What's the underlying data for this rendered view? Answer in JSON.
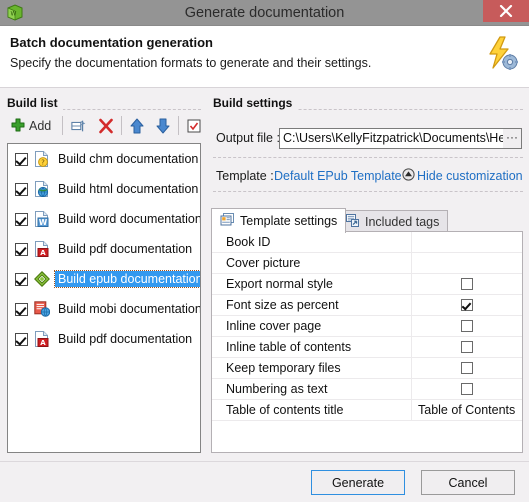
{
  "window": {
    "title": "Generate documentation",
    "app_icon": "green-cube-icon",
    "close_label": "✕"
  },
  "header": {
    "title": "Batch documentation generation",
    "subtitle": "Specify the documentation formats to generate and their settings.",
    "icon": "lightning-gear-icon"
  },
  "build_list": {
    "section_label": "Build list",
    "toolbar": {
      "add_label": "Add",
      "add_icon": "plus-icon",
      "rename_icon": "rename-icon",
      "delete_icon": "delete-x-icon",
      "move_up_icon": "arrow-up-icon",
      "move_down_icon": "arrow-down-icon",
      "check_all_icon": "check-all-icon"
    },
    "items": [
      {
        "label": "Build chm documentation",
        "checked": true,
        "selected": false,
        "icon": "chm-file-icon"
      },
      {
        "label": "Build html documentation",
        "checked": true,
        "selected": false,
        "icon": "html-file-icon"
      },
      {
        "label": "Build word documentation",
        "checked": true,
        "selected": false,
        "icon": "word-file-icon"
      },
      {
        "label": "Build pdf documentation",
        "checked": true,
        "selected": false,
        "icon": "pdf-file-icon"
      },
      {
        "label": "Build epub documentation",
        "checked": true,
        "selected": true,
        "icon": "epub-file-icon"
      },
      {
        "label": "Build mobi documentation",
        "checked": true,
        "selected": false,
        "icon": "mobi-file-icon"
      },
      {
        "label": "Build pdf documentation",
        "checked": true,
        "selected": false,
        "icon": "pdf-file-icon"
      }
    ]
  },
  "build_settings": {
    "section_label": "Build settings",
    "output_file_label": "Output file :",
    "output_file_value": "C:\\Users\\KellyFitzpatrick\\Documents\\HelpND",
    "browse_label": "···",
    "template_label": "Template :",
    "template_value": "Default EPub Template",
    "hide_customization_label": "Hide customization",
    "hide_customization_icon": "collapse-up-icon",
    "tabs": [
      {
        "label": "Template settings",
        "icon": "template-settings-icon",
        "active": true
      },
      {
        "label": "Included tags",
        "icon": "included-tags-icon",
        "active": false
      }
    ],
    "settings_rows": [
      {
        "name": "Book ID",
        "type": "text",
        "value": ""
      },
      {
        "name": "Cover picture",
        "type": "text",
        "value": ""
      },
      {
        "name": "Export normal style",
        "type": "checkbox",
        "checked": false
      },
      {
        "name": "Font size as percent",
        "type": "checkbox",
        "checked": true
      },
      {
        "name": "Inline cover page",
        "type": "checkbox",
        "checked": false
      },
      {
        "name": "Inline table of contents",
        "type": "checkbox",
        "checked": false
      },
      {
        "name": "Keep temporary files",
        "type": "checkbox",
        "checked": false
      },
      {
        "name": "Numbering as text",
        "type": "checkbox",
        "checked": false
      },
      {
        "name": "Table of contents title",
        "type": "text",
        "value": "Table of Contents"
      }
    ]
  },
  "footer": {
    "generate_label": "Generate",
    "cancel_label": "Cancel"
  },
  "colors": {
    "titlebar": "#949494",
    "close": "#c75b5b",
    "selection": "#3399ef",
    "link": "#1f6fc4",
    "default_button_border": "#2f8fe0"
  }
}
